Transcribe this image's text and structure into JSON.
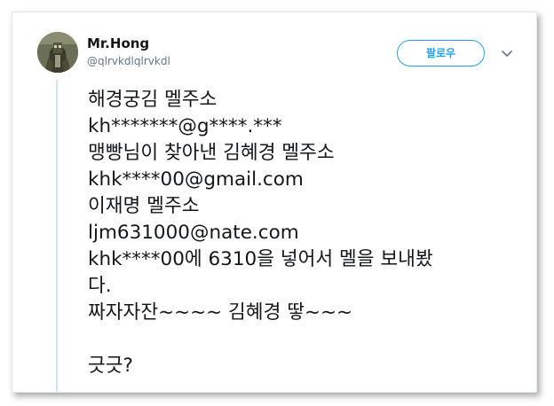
{
  "tweet": {
    "display_name": "Mr.Hong",
    "handle": "@qlrvkdlqlrvkdl",
    "follow_label": "팔로우",
    "lines": [
      "해경궁김 멜주소",
      "kh*******@g****.***",
      "맹빵님이 찾아낸 김혜경 멜주소",
      "khk****00@gmail.com",
      "이재명 멜주소",
      "ljm631000@nate.com",
      "khk****00에 6310을 넣어서 멜을 보내봤",
      "다.",
      "짜자자잔~~~~ 김혜경 땋~~~",
      "",
      "긋긋?"
    ]
  },
  "colors": {
    "accent": "#1da1f2",
    "text": "#14171a",
    "muted": "#657786",
    "thread_line": "#cce3f3"
  },
  "icons": {
    "avatar": "profile-avatar",
    "caret": "chevron-down-icon"
  }
}
